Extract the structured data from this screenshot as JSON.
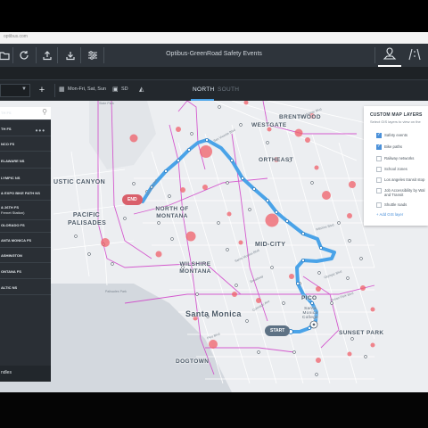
{
  "browser": {
    "url": "optibus.com"
  },
  "app": {
    "title": "Optibus-GreenRoad Safety Events",
    "toolbar_icons": [
      "folder-icon",
      "refresh-icon",
      "upload-icon",
      "download-icon",
      "sliders-icon"
    ],
    "mode_icons": [
      "map-pin-icon",
      "route-icon"
    ]
  },
  "toolbar": {
    "add_label": "+",
    "days": "Mon-Fri, Sat, Sun",
    "vehicle": "SD",
    "tabs": {
      "north": "NORTH",
      "south": "SOUTH"
    }
  },
  "left_panel": {
    "search_placeholder": "",
    "more_label": "•••",
    "items": [
      "TH FS",
      "TH FS",
      "NCO FS",
      "ELAWARE NS",
      "LYMPIC NS",
      "& EXPO BIKE PATH NS",
      "& 26TH FS",
      "Fernet Station)",
      "OLORADO FS",
      "ANTA MONICA FS",
      "ASHINGTON",
      "ONTANA FS",
      "ALTIC NS"
    ],
    "footer_label": "ndles"
  },
  "map": {
    "neighborhoods": {
      "brentwood": "BRENTWOOD",
      "westgate": "WESTGATE",
      "rustic_canyon": "USTIC CANYON",
      "northeast": "ORTHEAST",
      "north_of_montana": "NORTH OF MONTANA",
      "pacific_palisades": "PACIFIC PALISADES",
      "mid_city": "MID-CITY",
      "wilshire_montana": "WILSHIRE MONTANA",
      "santa_monica": "Santa Monica",
      "pico": "PICO",
      "sunset_park": "SUNSET PARK",
      "dogtown": "DOGTOWN",
      "santa_monica_college": "Santa Monica College"
    },
    "streets": {
      "state_park": "State Park",
      "san_vicente_1": "San Vicente Blvd",
      "san_vicente_2": "San Vicente Blvd",
      "palisades_park": "Palisades Park",
      "wilshire": "Wilshire Blvd",
      "santa_monica_blvd": "Santa Monica Blvd",
      "broadway": "Broadway",
      "olympic": "Olympic Blvd",
      "pico_blvd": "Pico Blvd",
      "ocean_park": "Ocean Park Blvd",
      "colorado": "Colorado Ave",
      "montana": "Montana Ave"
    },
    "end_label": "END",
    "start_label": "START"
  },
  "layers_panel": {
    "title": "CUSTOM MAP LAYERS",
    "subtitle": "Select GIS layers to view on the",
    "layers": [
      {
        "label": "Safety events",
        "checked": true
      },
      {
        "label": "Bike paths",
        "checked": true
      },
      {
        "label": "Railway networks",
        "checked": false
      },
      {
        "label": "School zones",
        "checked": false
      },
      {
        "label": "Los angeles transit stop",
        "checked": false
      },
      {
        "label": "Job Accessibility by Wal",
        "label2": "and Transit",
        "checked": false
      },
      {
        "label": "Shuttle roads",
        "checked": false
      }
    ],
    "add_label": "+ Add GIS layer"
  },
  "colors": {
    "route": "#4aa3e8",
    "safety_event": "#f0606a",
    "bike_path": "#d040c8",
    "app_bar": "#2e343b",
    "panel_dark": "#2a2f35"
  }
}
